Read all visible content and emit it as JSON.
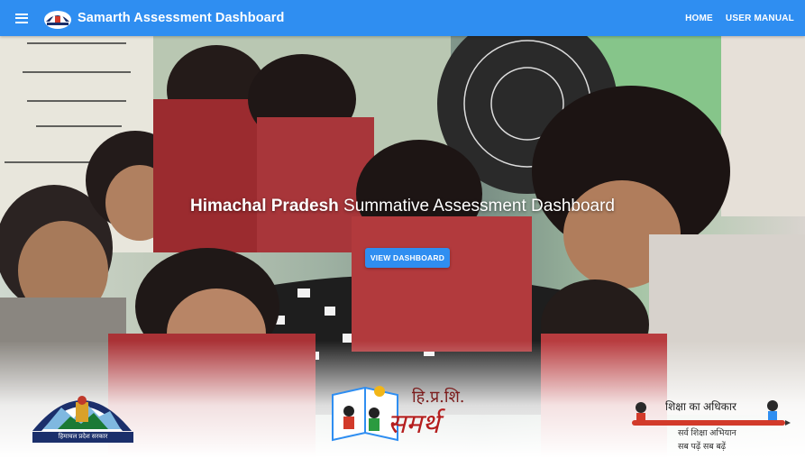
{
  "header": {
    "title": "Samarth Assessment Dashboard",
    "menu_icon": "menu-icon",
    "logo_icon": "himachal-logo-icon",
    "nav": [
      {
        "label": "HOME"
      },
      {
        "label": "USER MANUAL"
      }
    ]
  },
  "hero": {
    "title_bold": "Himachal Pradesh",
    "title_rest": " Summative Assessment Dashboard",
    "button_label": "VIEW DASHBOARD"
  },
  "logos": {
    "left_caption": "हिमाचल प्रदेश सरकार",
    "center_top": "हि.प्र.शि.",
    "center_main": "समर्थ",
    "right_title": "शिक्षा का अधिकार",
    "right_line1": "सर्व शिक्षा अभियान",
    "right_line2": "सब पढ़ें सब बढ़ें"
  },
  "colors": {
    "appbar": "#2f8ef1",
    "button": "#2f8ef1",
    "samarth_red": "#b51e1e"
  }
}
